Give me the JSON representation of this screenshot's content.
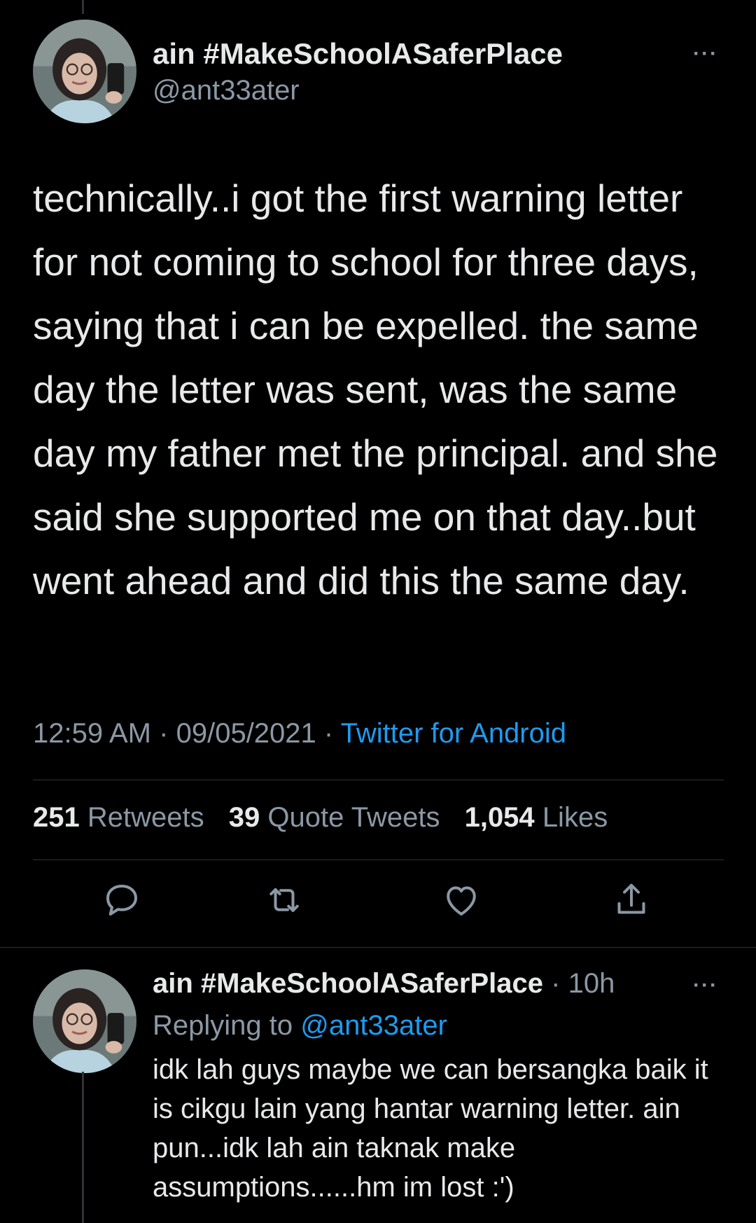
{
  "main_tweet": {
    "display_name": "ain #MakeSchoolASaferPlace",
    "handle": "@ant33ater",
    "text": "technically..i got the first warning letter for not coming to school for three days, saying that i can be expelled. the same day the letter was sent, was the same day my father met the principal. and she said she supported me on that day..but went ahead and did this the same day.",
    "time": "12:59 AM",
    "separator": "·",
    "date": "09/05/2021",
    "source": "Twitter for Android",
    "more_label": "···"
  },
  "stats": {
    "retweets_count": "251",
    "retweets_label": "Retweets",
    "quotes_count": "39",
    "quotes_label": "Quote Tweets",
    "likes_count": "1,054",
    "likes_label": "Likes"
  },
  "actions": [
    {
      "icon": "reply-icon"
    },
    {
      "icon": "retweet-icon"
    },
    {
      "icon": "like-icon"
    },
    {
      "icon": "share-icon"
    }
  ],
  "reply_tweet": {
    "display_name": "ain #MakeSchoolASaferPlace",
    "separator": "·",
    "time_ago": "10h",
    "replying_label": "Replying to",
    "replying_to": "@ant33ater",
    "text": "idk lah guys maybe we can bersangka baik it is cikgu lain yang hantar warning letter. ain pun...idk lah ain taknak make assumptions......hm im lost :')",
    "more_label": "···"
  },
  "colors": {
    "background": "#000000",
    "text": "#e7e9ea",
    "secondary": "#8b98a5",
    "link": "#1d9bf0",
    "divider": "#2f3336"
  }
}
